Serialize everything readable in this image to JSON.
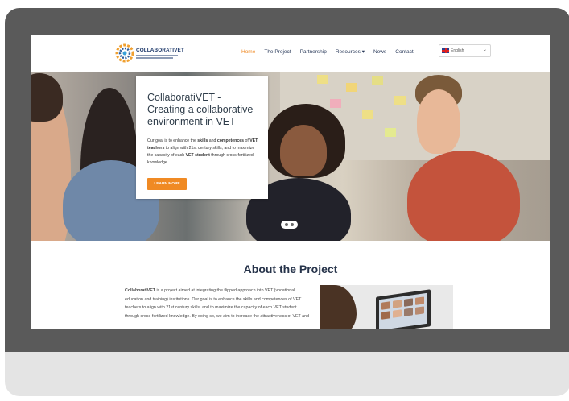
{
  "site": {
    "logo_text": "COLLABORATIVET",
    "nav": [
      "Home",
      "The Project",
      "Partnership",
      "Resources",
      "News",
      "Contact"
    ],
    "nav_dropdown_caret": "▾",
    "language": {
      "flag": "uk-flag-icon",
      "selected": "English"
    }
  },
  "hero": {
    "title": "CollaboratiVET - Creating a collaborative environment in VET",
    "text_parts": {
      "p1": "Our goal is to enhance the ",
      "b1": "skills",
      "p2": " and ",
      "b2": "competences",
      "p3": " of ",
      "b3": "VET teachers",
      "p4": " to align with 21st century skills, and to maximize the capacity of each ",
      "b4": "VET student",
      "p5": " through cross-fertilized knowledge."
    },
    "button": "LEARN MORE"
  },
  "about": {
    "title": "About the Project",
    "text_bold": "CollaboratiVET",
    "text": " is a project aimed at integrating the flipped approach into VET (vocational education and training) institutions. Our goal is to enhance the skills and competences of VET teachers to align with 21st century skills, and to maximize the capacity of each VET student through cross-fertilized knowledge. By doing so, we aim to increase the attractiveness of VET and"
  },
  "colors": {
    "accent": "#f08a24",
    "heading": "#26334a",
    "frame": "#5a5a5a",
    "background": "#e4e4e4"
  }
}
